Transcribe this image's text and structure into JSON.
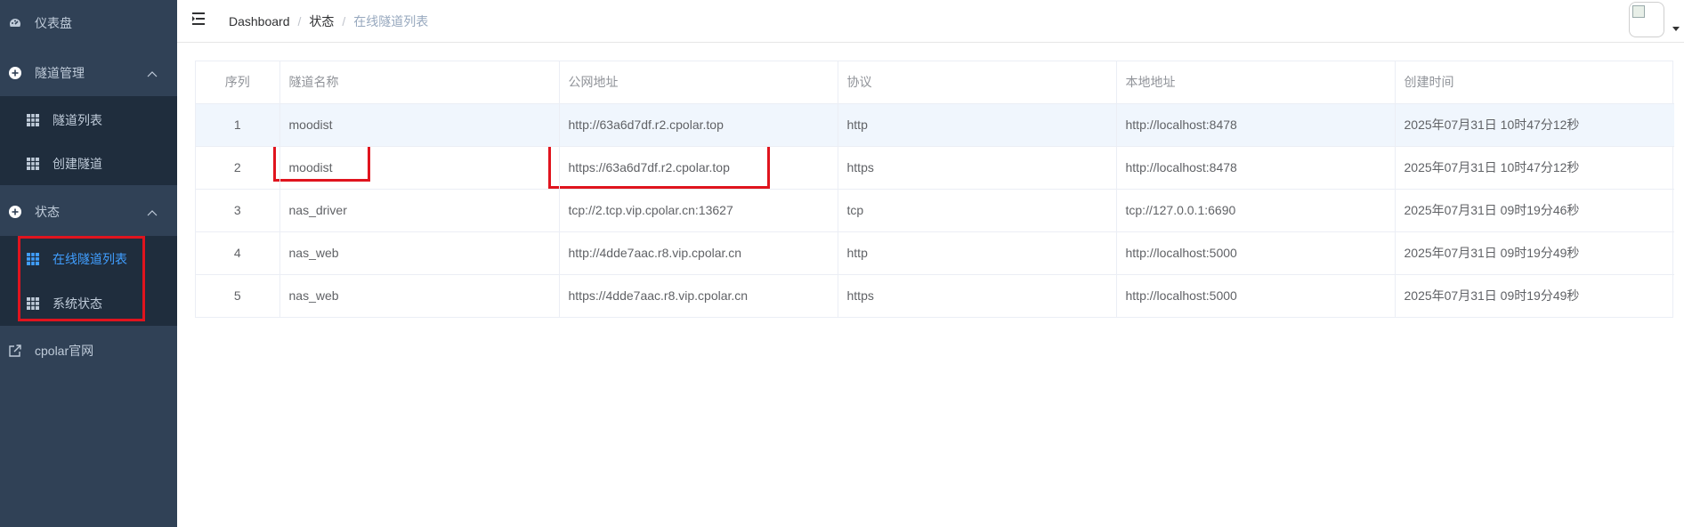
{
  "sidebar": {
    "dashboard": "仪表盘",
    "tunnel_mgmt": "隧道管理",
    "tunnel_list": "隧道列表",
    "create_tunnel": "创建隧道",
    "status": "状态",
    "online_tunnels": "在线隧道列表",
    "system_status": "系统状态",
    "official_site": "cpolar官网"
  },
  "breadcrumb": {
    "home": "Dashboard",
    "section": "状态",
    "current": "在线隧道列表",
    "separator": "/"
  },
  "table": {
    "headers": [
      "序列",
      "隧道名称",
      "公网地址",
      "协议",
      "本地地址",
      "创建时间"
    ],
    "rows": [
      [
        "1",
        "moodist",
        "http://63a6d7df.r2.cpolar.top",
        "http",
        "http://localhost:8478",
        "2025年07月31日 10时47分12秒"
      ],
      [
        "2",
        "moodist",
        "https://63a6d7df.r2.cpolar.top",
        "https",
        "http://localhost:8478",
        "2025年07月31日 10时47分12秒"
      ],
      [
        "3",
        "nas_driver",
        "tcp://2.tcp.vip.cpolar.cn:13627",
        "tcp",
        "tcp://127.0.0.1:6690",
        "2025年07月31日 09时19分46秒"
      ],
      [
        "4",
        "nas_web",
        "http://4dde7aac.r8.vip.cpolar.cn",
        "http",
        "http://localhost:5000",
        "2025年07月31日 09时19分49秒"
      ],
      [
        "5",
        "nas_web",
        "https://4dde7aac.r8.vip.cpolar.cn",
        "https",
        "http://localhost:5000",
        "2025年07月31日 09时19分49秒"
      ]
    ]
  },
  "colors": {
    "sidebar_bg": "#304156",
    "submenu_bg": "#1f2d3d",
    "active": "#409eff",
    "highlight_box": "#e0141e",
    "row_hover": "#f0f6fd"
  }
}
